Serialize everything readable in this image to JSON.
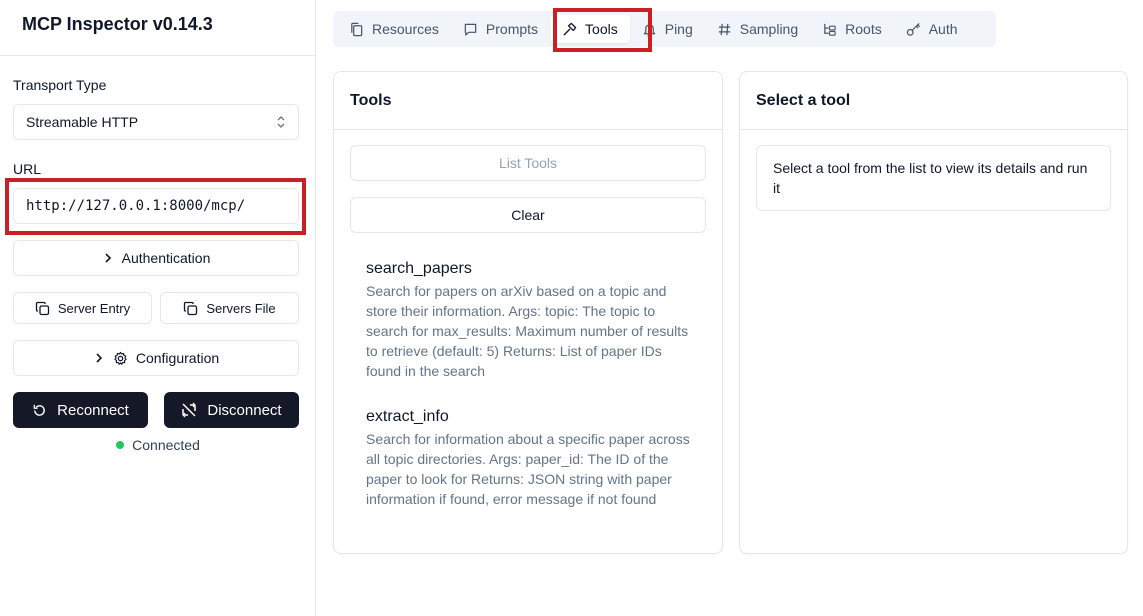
{
  "app": {
    "title": "MCP Inspector v0.14.3"
  },
  "sidebar": {
    "transport_label": "Transport Type",
    "transport_value": "Streamable HTTP",
    "url_label": "URL",
    "url_value": "http://127.0.0.1:8000/mcp/",
    "authentication_label": "Authentication",
    "server_entry_label": "Server Entry",
    "servers_file_label": "Servers File",
    "configuration_label": "Configuration",
    "reconnect_label": "Reconnect",
    "disconnect_label": "Disconnect",
    "status_text": "Connected",
    "status_color": "#22c55e"
  },
  "tabs": [
    {
      "label": "Resources",
      "icon": "files-icon"
    },
    {
      "label": "Prompts",
      "icon": "message-icon"
    },
    {
      "label": "Tools",
      "icon": "hammer-icon",
      "active": true
    },
    {
      "label": "Ping",
      "icon": "bell-icon"
    },
    {
      "label": "Sampling",
      "icon": "hash-icon"
    },
    {
      "label": "Roots",
      "icon": "folder-tree-icon"
    },
    {
      "label": "Auth",
      "icon": "key-icon"
    }
  ],
  "tools_panel": {
    "title": "Tools",
    "list_tools_label": "List Tools",
    "clear_label": "Clear",
    "tools": [
      {
        "name": "search_papers",
        "description": "Search for papers on arXiv based on a topic and store their information. Args: topic: The topic to search for max_results: Maximum number of results to retrieve (default: 5) Returns: List of paper IDs found in the search"
      },
      {
        "name": "extract_info",
        "description": "Search for information about a specific paper across all topic directories. Args: paper_id: The ID of the paper to look for Returns: JSON string with paper information if found, error message if not found"
      }
    ]
  },
  "detail_panel": {
    "title": "Select a tool",
    "message": "Select a tool from the list to view its details and run it"
  },
  "accent": {
    "highlight": "#c91f25",
    "dark_button": "#141827"
  }
}
